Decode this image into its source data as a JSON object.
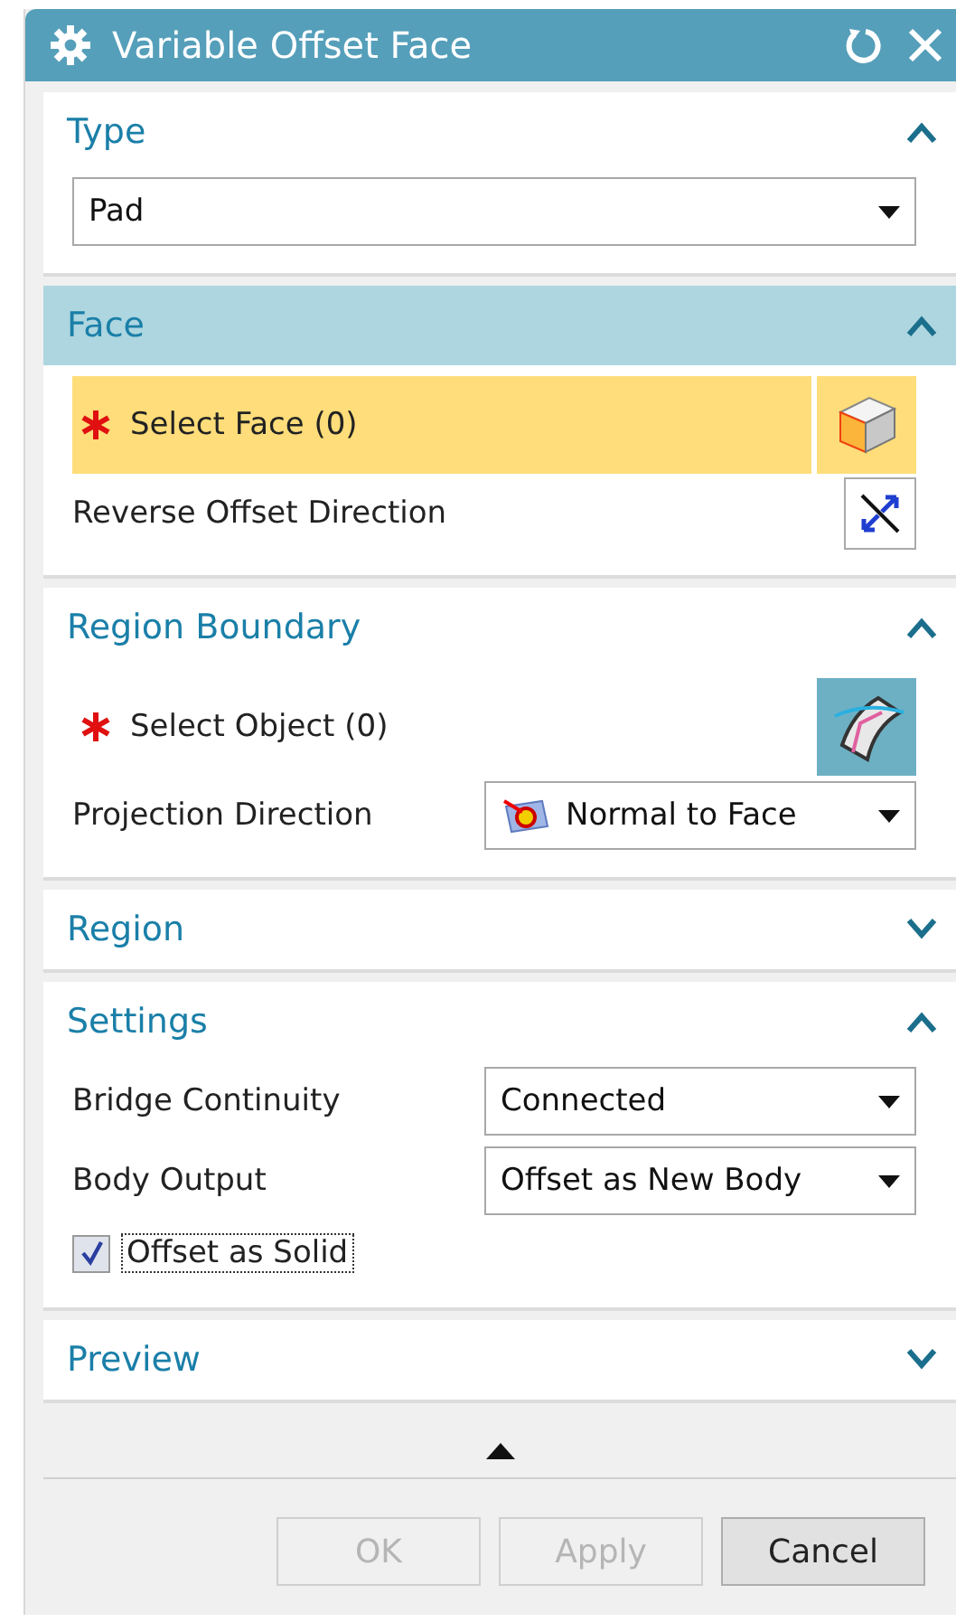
{
  "window": {
    "title": "Variable Offset Face"
  },
  "sections": [
    {
      "title": "Type",
      "expanded": true,
      "selected": false,
      "rows": [
        {
          "kind": "dropdown",
          "value": "Pad"
        }
      ]
    },
    {
      "title": "Face",
      "expanded": true,
      "selected": true,
      "rows": [
        {
          "kind": "face-select",
          "label": "Select Face (0)",
          "active": true
        },
        {
          "kind": "toggle",
          "label": "Reverse Offset Direction"
        }
      ]
    },
    {
      "title": "Region Boundary",
      "expanded": true,
      "selected": false,
      "rows": [
        {
          "kind": "object-select",
          "label": "Select Object (0)",
          "active": false
        },
        {
          "kind": "direction",
          "label": "Projection Direction",
          "value": "Normal to Face"
        }
      ]
    },
    {
      "title": "Region",
      "expanded": false,
      "selected": false
    },
    {
      "title": "Settings",
      "expanded": true,
      "selected": false,
      "rows": [
        {
          "kind": "field",
          "label": "Bridge Continuity",
          "value": "Connected"
        },
        {
          "kind": "field",
          "label": "Body Output",
          "value": "Offset as New Body"
        },
        {
          "kind": "checkbox",
          "label": "Offset as Solid",
          "checked": true
        }
      ]
    },
    {
      "title": "Preview",
      "expanded": false,
      "selected": false
    }
  ],
  "buttons": [
    {
      "label": "OK",
      "disabled": true
    },
    {
      "label": "Apply",
      "disabled": true
    },
    {
      "label": "Cancel",
      "disabled": false
    }
  ]
}
